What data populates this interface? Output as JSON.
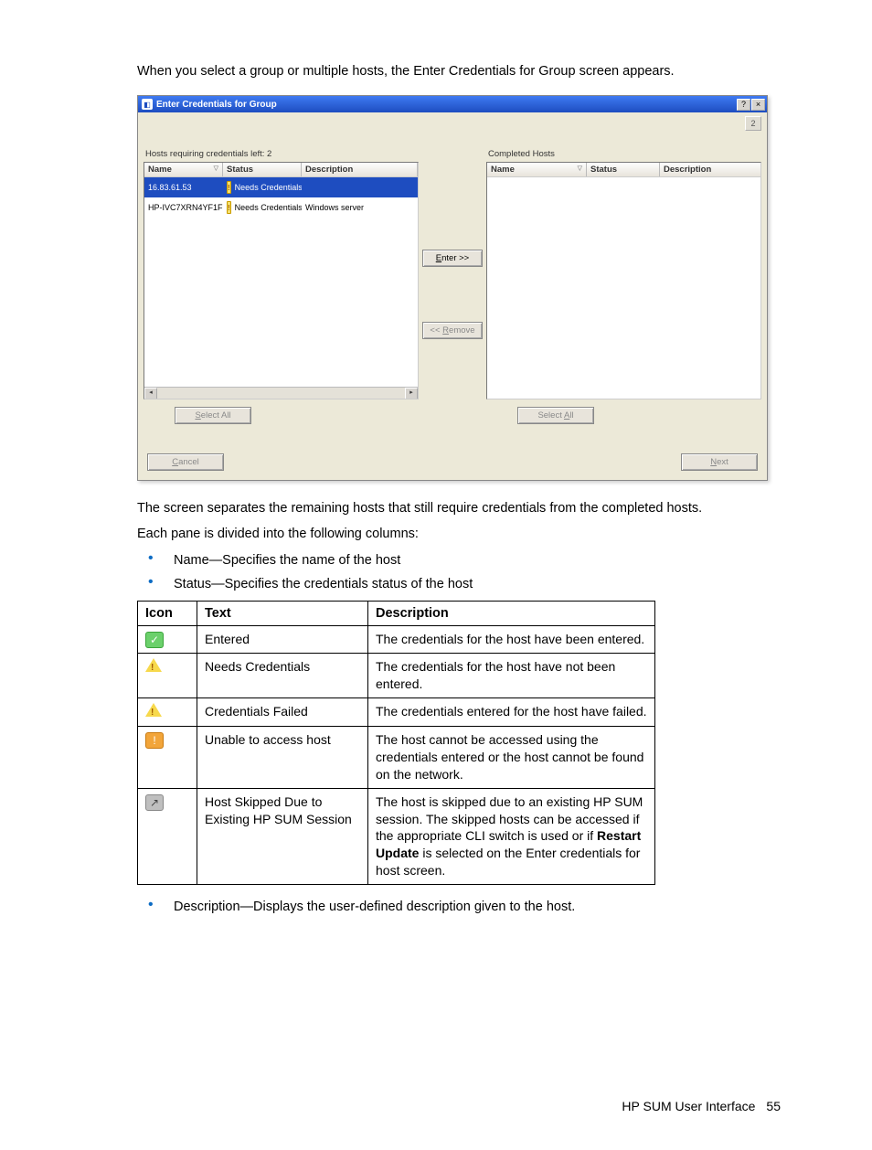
{
  "intro": "When you select a group or multiple hosts, the Enter Credentials for Group screen appears.",
  "dialog": {
    "title": "Enter Credentials for Group",
    "help_btn": "?",
    "close_btn": "×",
    "step_label": "2",
    "left_label": "Hosts requiring credentials left: 2",
    "right_label": "Completed Hosts",
    "left_headers": {
      "name": "Name",
      "status": "Status",
      "desc": "Description"
    },
    "right_headers": {
      "name": "Name",
      "status": "Status",
      "desc": "Description"
    },
    "left_rows": [
      {
        "name": "16.83.61.53",
        "status": "Needs Credentials",
        "desc": "",
        "selected": true
      },
      {
        "name": "HP-IVC7XRN4YF1F",
        "status": "Needs Credentials",
        "desc": "Windows server",
        "selected": false
      }
    ],
    "enter_btn_prefix": "E",
    "enter_btn_rest": "nter >>",
    "remove_btn_prefix": "<< ",
    "remove_btn_key": "R",
    "remove_btn_rest": "emove",
    "select_all_left_key": "S",
    "select_all_left_rest": "elect All",
    "select_all_right_prefix": "Select ",
    "select_all_right_key": "A",
    "select_all_right_rest": "ll",
    "cancel_key": "C",
    "cancel_rest": "ancel",
    "next_key": "N",
    "next_rest": "ext"
  },
  "after_ss": {
    "p1": "The screen separates the remaining hosts that still require credentials from the completed hosts.",
    "p2": "Each pane is divided into the following columns:",
    "bullets_a": [
      "Name—Specifies the name of the host",
      "Status—Specifies the credentials status of the host"
    ],
    "bullets_b": [
      "Description—Displays the user-defined description given to the host."
    ]
  },
  "status_table": {
    "headers": {
      "icon": "Icon",
      "text": "Text",
      "desc": "Description"
    },
    "rows": [
      {
        "icon": "green-check",
        "text": "Entered",
        "desc": "The credentials for the host have been entered."
      },
      {
        "icon": "yellow-tri",
        "text": "Needs Credentials",
        "desc": "The credentials for the host have not been entered."
      },
      {
        "icon": "yellow-tri",
        "text": "Credentials Failed",
        "desc": "The credentials entered for the host have failed."
      },
      {
        "icon": "orange-sq",
        "text": "Unable to access host",
        "desc": "The host cannot be accessed using the credentials entered or the host cannot be found on the network."
      },
      {
        "icon": "gray-sq",
        "text": "Host Skipped Due to Existing HP SUM Session",
        "desc_pre": "The host is skipped due to an existing HP SUM session. The skipped hosts can be accessed if the appropriate CLI switch is used or if ",
        "desc_bold": "Restart Update",
        "desc_post": " is selected on the Enter credentials for host screen."
      }
    ]
  },
  "footer": {
    "label": "HP SUM User Interface",
    "page": "55"
  }
}
